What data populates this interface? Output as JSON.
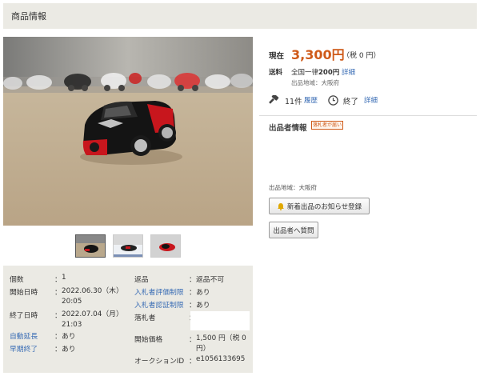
{
  "header": {
    "title": "商品情報"
  },
  "price": {
    "label": "現在",
    "value": "3,300円",
    "tax": "（税 0 円）"
  },
  "shipping": {
    "label": "送料",
    "prefix": "全国一律",
    "amount": "200円",
    "detail_link": "詳細",
    "location": "出品地域：大阪府"
  },
  "bids": {
    "count": "11件",
    "history_link": "履歴",
    "status": "終了",
    "detail_link": "詳細"
  },
  "seller": {
    "title": "出品者情報",
    "badge": "落札者が届い",
    "location": "出品地域：大阪府",
    "notify_button": "新着出品のお知らせ登録",
    "question_button": "出品者へ質問"
  },
  "details": {
    "left": [
      {
        "label": "個数",
        "value": "1"
      },
      {
        "label": "開始日時",
        "value": "2022.06.30（木）20:05"
      },
      {
        "label": "終了日時",
        "value": "2022.07.04（月）21:03"
      },
      {
        "label": "自動延長",
        "value": "あり"
      },
      {
        "label": "早期終了",
        "value": "あり"
      }
    ],
    "right": [
      {
        "label": "返品",
        "value": "返品不可"
      },
      {
        "label": "入札者評価制限",
        "value": "あり"
      },
      {
        "label": "入札者認証制限",
        "value": "あり"
      },
      {
        "label": "落札者",
        "value": ""
      },
      {
        "label": "開始価格",
        "value": "1,500 円（税 0 円）"
      },
      {
        "label": "オークションID",
        "value": "e1056133695"
      }
    ]
  },
  "icons": {
    "gavel": "gavel-icon",
    "clock": "clock-icon",
    "bell": "bell-icon"
  },
  "colors": {
    "price": "#cf5a19",
    "link": "#3a6db5",
    "panel": "#ebeae4"
  }
}
